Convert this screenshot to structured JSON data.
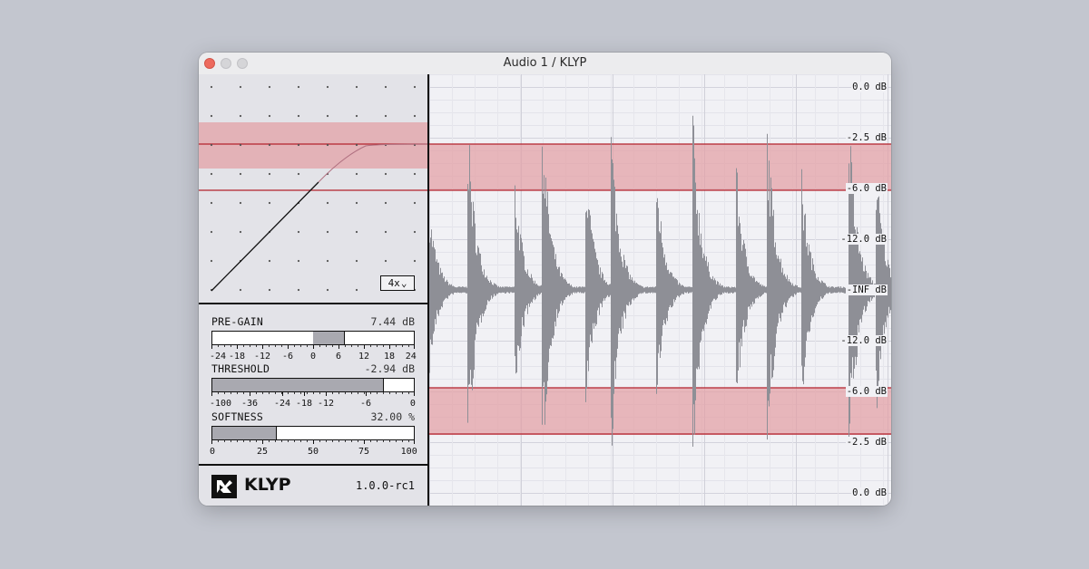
{
  "window": {
    "title": "Audio 1 / KLYP"
  },
  "oversampling": {
    "value": "4x",
    "chevron": "chevron-down-icon"
  },
  "params": [
    {
      "label": "PRE-GAIN",
      "value": "7.44 dB",
      "min": -24,
      "max": 24,
      "fill_from": 0,
      "fill_to": 7.44,
      "ticks": [
        "-24",
        "-18",
        "-12",
        "-6",
        "0",
        "6",
        "12",
        "18",
        "24"
      ]
    },
    {
      "label": "THRESHOLD",
      "value": "-2.94 dB",
      "fill_fraction": 0.85,
      "ticks": [
        "-100",
        "-36",
        "-24",
        "-18",
        "-12",
        "-6",
        "0"
      ]
    },
    {
      "label": "SOFTNESS",
      "value": "32.00 %",
      "min": 0,
      "max": 100,
      "fill_from": 0,
      "fill_to": 32,
      "ticks": [
        "0",
        "25",
        "50",
        "75",
        "100"
      ]
    }
  ],
  "brand": {
    "name": "KLYP",
    "version": "1.0.0-rc1",
    "logo": "klyp-logo-icon"
  },
  "waveform": {
    "db_labels": [
      "0.0 dB",
      "-2.5 dB",
      "-6.0 dB",
      "-12.0 dB",
      "-INF dB",
      "-12.0 dB",
      "-6.0 dB",
      "-2.5 dB",
      "0.0 dB"
    ]
  },
  "colors": {
    "clip_band": "#e3a1a7",
    "clip_line": "#b3222c",
    "waveform": "#8e8f96",
    "accent": "#111111"
  }
}
